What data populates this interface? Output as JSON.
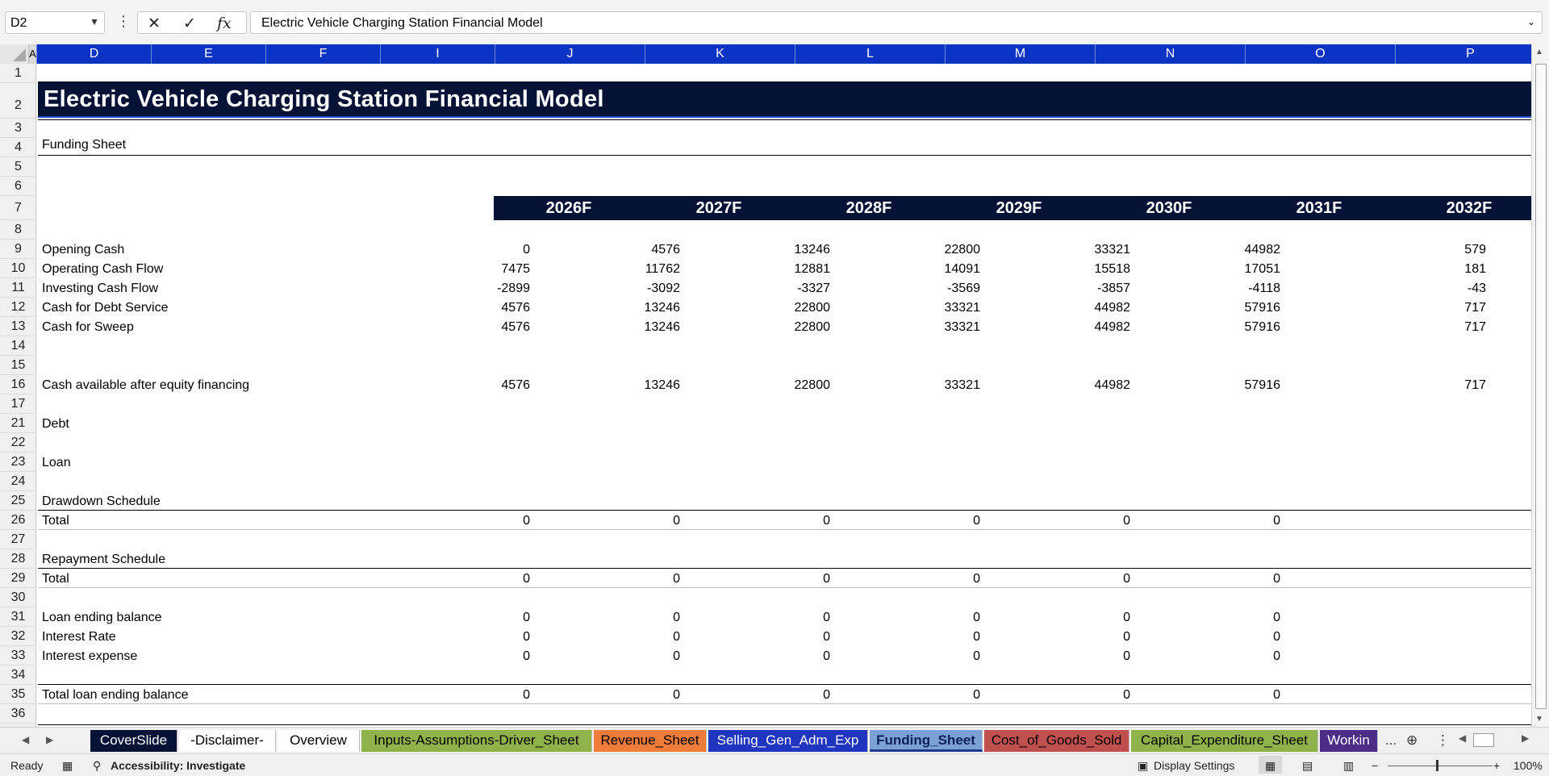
{
  "formula_bar": {
    "name_box": "D2",
    "content": "Electric Vehicle Charging Station Financial Model",
    "cancel_glyph": "✕",
    "enter_glyph": "✓",
    "fx_glyph": "fx"
  },
  "columns": [
    "A",
    "D",
    "E",
    "F",
    "I",
    "J",
    "K",
    "L",
    "M",
    "N",
    "O",
    "P"
  ],
  "rows": [
    "1",
    "2",
    "3",
    "4",
    "5",
    "6",
    "7",
    "8",
    "9",
    "10",
    "11",
    "12",
    "13",
    "14",
    "15",
    "16",
    "17",
    "21",
    "22",
    "23",
    "24",
    "25",
    "26",
    "27",
    "28",
    "29",
    "30",
    "31",
    "32",
    "33",
    "34",
    "35",
    "36"
  ],
  "sheet": {
    "title": "Electric Vehicle Charging Station Financial Model",
    "subtitle": "Funding Sheet",
    "years": [
      "2026F",
      "2027F",
      "2028F",
      "2029F",
      "2030F",
      "2031F",
      "2032F"
    ],
    "lines": [
      {
        "label": "Opening Cash",
        "values": [
          "0",
          "4576",
          "13246",
          "22800",
          "33321",
          "44982",
          "579"
        ]
      },
      {
        "label": "Operating Cash Flow",
        "values": [
          "7475",
          "11762",
          "12881",
          "14091",
          "15518",
          "17051",
          "181"
        ]
      },
      {
        "label": "Investing Cash Flow",
        "values": [
          "-2899",
          "-3092",
          "-3327",
          "-3569",
          "-3857",
          "-4118",
          "-43"
        ]
      },
      {
        "label": "Cash for Debt Service",
        "values": [
          "4576",
          "13246",
          "22800",
          "33321",
          "44982",
          "57916",
          "717"
        ]
      },
      {
        "label": "Cash for Sweep",
        "values": [
          "4576",
          "13246",
          "22800",
          "33321",
          "44982",
          "57916",
          "717"
        ]
      },
      {
        "label": "Cash available after equity financing",
        "values": [
          "4576",
          "13246",
          "22800",
          "33321",
          "44982",
          "57916",
          "717"
        ]
      },
      {
        "label": "Debt",
        "values": []
      },
      {
        "label": "Loan",
        "values": []
      },
      {
        "label": "Drawdown Schedule",
        "values": []
      },
      {
        "label": "Total",
        "values": [
          "0",
          "0",
          "0",
          "0",
          "0",
          "0"
        ]
      },
      {
        "label": "Repayment Schedule",
        "values": []
      },
      {
        "label": "Total",
        "values": [
          "0",
          "0",
          "0",
          "0",
          "0",
          "0"
        ]
      },
      {
        "label": "Loan ending balance",
        "values": [
          "0",
          "0",
          "0",
          "0",
          "0",
          "0"
        ]
      },
      {
        "label": "Interest Rate",
        "values": [
          "0",
          "0",
          "0",
          "0",
          "0",
          "0"
        ]
      },
      {
        "label": "Interest expense",
        "values": [
          "0",
          "0",
          "0",
          "0",
          "0",
          "0"
        ]
      },
      {
        "label": "Total loan ending balance",
        "values": [
          "0",
          "0",
          "0",
          "0",
          "0",
          "0"
        ]
      }
    ]
  },
  "tabs": [
    {
      "label": "CoverSlide",
      "bg": "#061235",
      "fg": "#ffffff"
    },
    {
      "label": "-Disclaimer-",
      "bg": "#ffffff",
      "fg": "#000000"
    },
    {
      "label": "Overview",
      "bg": "#ffffff",
      "fg": "#000000"
    },
    {
      "label": "Inputs-Assumptions-Driver_Sheet",
      "bg": "#8fb34a",
      "fg": "#000000"
    },
    {
      "label": "Revenue_Sheet",
      "bg": "#f07c3c",
      "fg": "#000000"
    },
    {
      "label": "Selling_Gen_Adm_Exp",
      "bg": "#1f35c0",
      "fg": "#ffffff"
    },
    {
      "label": "Funding_Sheet",
      "bg": "#ffffff",
      "fg": "#1f3a8a",
      "active": true
    },
    {
      "label": "Cost_of_Goods_Sold",
      "bg": "#c0504d",
      "fg": "#000000"
    },
    {
      "label": "Capital_Expenditure_Sheet",
      "bg": "#8fb34a",
      "fg": "#000000"
    },
    {
      "label": "Workin",
      "bg": "#4b2c86",
      "fg": "#ffffff"
    }
  ],
  "tab_overflow": "...",
  "status": {
    "ready": "Ready",
    "accessibility": "Accessibility: Investigate",
    "display_settings": "Display Settings",
    "zoom": "100%",
    "zoom_minus": "−",
    "zoom_plus": "+"
  },
  "colors": {
    "header_blue": "#0b33c4",
    "title_navy": "#061235"
  }
}
